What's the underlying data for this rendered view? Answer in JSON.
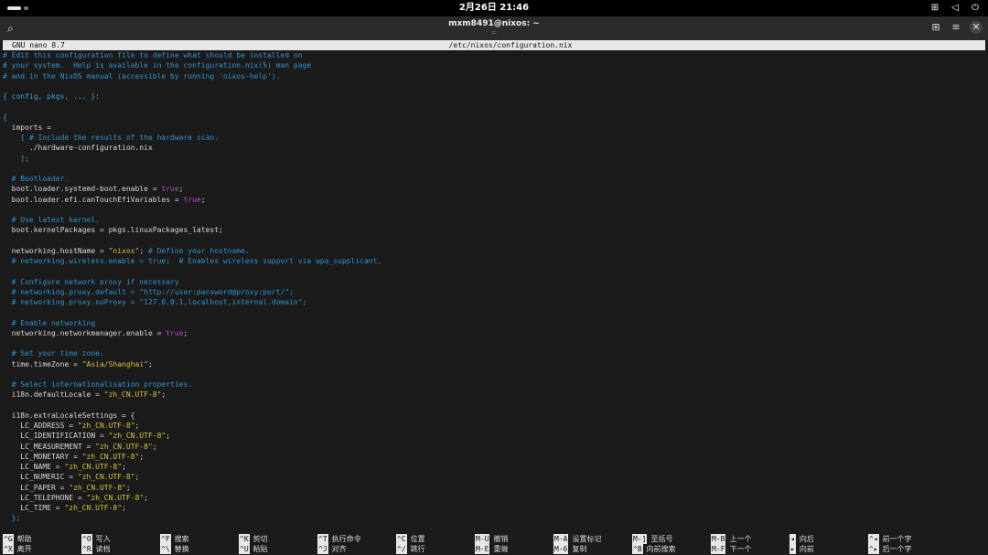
{
  "topbar": {
    "clock": "2月26日 21:46",
    "icons": [
      "network-icon",
      "volume-icon",
      "power-icon"
    ]
  },
  "titlebar": {
    "title": "mxm8491@nixos: ~",
    "subtitle": "=",
    "icons": [
      "search-icon",
      "new-tab-icon",
      "menu-icon",
      "close-icon"
    ]
  },
  "nano": {
    "version": "GNU nano 8.7",
    "filename": "/etc/nixos/configuration.nix"
  },
  "lines": [
    [
      [
        "# Edit this configuration file to define what should be installed on",
        "c"
      ]
    ],
    [
      [
        "# your system.  Help is available in the configuration.nix(5) man page",
        "c"
      ]
    ],
    [
      [
        "# and in the NixOS manual (accessible by running 'nixos-help').",
        "c"
      ]
    ],
    [
      [
        "",
        ""
      ]
    ],
    [
      [
        "{ config, pkgs, ... }:",
        "b"
      ]
    ],
    [
      [
        "",
        ""
      ]
    ],
    [
      [
        "{",
        "b"
      ]
    ],
    [
      [
        "  imports =",
        ""
      ]
    ],
    [
      [
        "    [ ",
        "b"
      ],
      [
        "# Include the results of the hardware scan.",
        "c"
      ]
    ],
    [
      [
        "      ./hardware-configuration.nix",
        ""
      ]
    ],
    [
      [
        "    ];",
        "b"
      ]
    ],
    [
      [
        "",
        ""
      ]
    ],
    [
      [
        "  # Bootloader.",
        "c"
      ]
    ],
    [
      [
        "  boot.loader.systemd-boot.enable = ",
        ""
      ],
      [
        "true",
        "k"
      ],
      [
        ";",
        ""
      ]
    ],
    [
      [
        "  boot.loader.efi.canTouchEfiVariables = ",
        ""
      ],
      [
        "true",
        "k"
      ],
      [
        ";",
        ""
      ]
    ],
    [
      [
        "",
        ""
      ]
    ],
    [
      [
        "  # Use latest kernel.",
        "c"
      ]
    ],
    [
      [
        "  boot.kernelPackages = pkgs.linuxPackages_latest;",
        ""
      ]
    ],
    [
      [
        "",
        ""
      ]
    ],
    [
      [
        "  networking.hostName = ",
        ""
      ],
      [
        "\"nixos\"",
        "s"
      ],
      [
        "; ",
        ""
      ],
      [
        "# Define your hostname.",
        "c"
      ]
    ],
    [
      [
        "  # networking.wireless.enable = true;  # Enables wireless support via wpa_supplicant.",
        "c"
      ]
    ],
    [
      [
        "",
        ""
      ]
    ],
    [
      [
        "  # Configure network proxy if necessary",
        "c"
      ]
    ],
    [
      [
        "  # networking.proxy.default = \"http://user:password@proxy:port/\";",
        "c"
      ]
    ],
    [
      [
        "  # networking.proxy.noProxy = \"127.0.0.1,localhost,internal.domain\";",
        "c"
      ]
    ],
    [
      [
        "",
        ""
      ]
    ],
    [
      [
        "  # Enable networking",
        "c"
      ]
    ],
    [
      [
        "  networking.networkmanager.enable = ",
        ""
      ],
      [
        "true",
        "k"
      ],
      [
        ";",
        ""
      ]
    ],
    [
      [
        "",
        ""
      ]
    ],
    [
      [
        "  # Set your time zone.",
        "c"
      ]
    ],
    [
      [
        "  time.timeZone = ",
        ""
      ],
      [
        "\"Asia/Shanghai\"",
        "s"
      ],
      [
        ";",
        ""
      ]
    ],
    [
      [
        "",
        ""
      ]
    ],
    [
      [
        "  # Select internationalisation properties.",
        "c"
      ]
    ],
    [
      [
        "  i18n.defaultLocale = ",
        ""
      ],
      [
        "\"zh_CN.UTF-8\"",
        "s"
      ],
      [
        ";",
        ""
      ]
    ],
    [
      [
        "",
        ""
      ]
    ],
    [
      [
        "  i18n.extraLocaleSettings = {",
        ""
      ]
    ],
    [
      [
        "    LC_ADDRESS = ",
        ""
      ],
      [
        "\"zh_CN.UTF-8\"",
        "s"
      ],
      [
        ";",
        ""
      ]
    ],
    [
      [
        "    LC_IDENTIFICATION = ",
        ""
      ],
      [
        "\"zh_CN.UTF-8\"",
        "s"
      ],
      [
        ";",
        ""
      ]
    ],
    [
      [
        "    LC_MEASUREMENT = ",
        ""
      ],
      [
        "\"zh_CN.UTF-8\"",
        "s"
      ],
      [
        ";",
        ""
      ]
    ],
    [
      [
        "    LC_MONETARY = ",
        ""
      ],
      [
        "\"zh_CN.UTF-8\"",
        "s"
      ],
      [
        ";",
        ""
      ]
    ],
    [
      [
        "    LC_NAME = ",
        ""
      ],
      [
        "\"zh_CN.UTF-8\"",
        "s"
      ],
      [
        ";",
        ""
      ]
    ],
    [
      [
        "    LC_NUMERIC = ",
        ""
      ],
      [
        "\"zh_CN.UTF-8\"",
        "s"
      ],
      [
        ";",
        ""
      ]
    ],
    [
      [
        "    LC_PAPER = ",
        ""
      ],
      [
        "\"zh_CN.UTF-8\"",
        "s"
      ],
      [
        ";",
        ""
      ]
    ],
    [
      [
        "    LC_TELEPHONE = ",
        ""
      ],
      [
        "\"zh_CN.UTF-8\"",
        "s"
      ],
      [
        ";",
        ""
      ]
    ],
    [
      [
        "    LC_TIME = ",
        ""
      ],
      [
        "\"zh_CN.UTF-8\"",
        "s"
      ],
      [
        ";",
        ""
      ]
    ],
    [
      [
        "  };",
        "b"
      ]
    ]
  ],
  "help": [
    [
      {
        "key": "^G",
        "label": "帮助"
      },
      {
        "key": "^X",
        "label": "离开"
      }
    ],
    [
      {
        "key": "^O",
        "label": "写入"
      },
      {
        "key": "^R",
        "label": "读档"
      }
    ],
    [
      {
        "key": "^F",
        "label": "搜索"
      },
      {
        "key": "^\\",
        "label": "替换"
      }
    ],
    [
      {
        "key": "^K",
        "label": "剪切"
      },
      {
        "key": "^U",
        "label": "粘贴"
      }
    ],
    [
      {
        "key": "^T",
        "label": "执行命令"
      },
      {
        "key": "^J",
        "label": "对齐"
      }
    ],
    [
      {
        "key": "^C",
        "label": "位置"
      },
      {
        "key": "^/",
        "label": "跳行"
      }
    ],
    [
      {
        "key": "M-U",
        "label": "撤销"
      },
      {
        "key": "M-E",
        "label": "重做"
      }
    ],
    [
      {
        "key": "M-A",
        "label": "设置标记"
      },
      {
        "key": "M-6",
        "label": "复制"
      }
    ],
    [
      {
        "key": "M-]",
        "label": "至括号"
      },
      {
        "key": "^B",
        "label": "向前搜索"
      }
    ],
    [
      {
        "key": "M-B",
        "label": "上一个"
      },
      {
        "key": "M-F",
        "label": "下一个"
      }
    ],
    [
      {
        "key": "◂",
        "label": "向后"
      },
      {
        "key": "▸",
        "label": "向前"
      }
    ],
    [
      {
        "key": "^◂",
        "label": "前一个字"
      },
      {
        "key": "^▸",
        "label": "后一个字"
      }
    ]
  ]
}
